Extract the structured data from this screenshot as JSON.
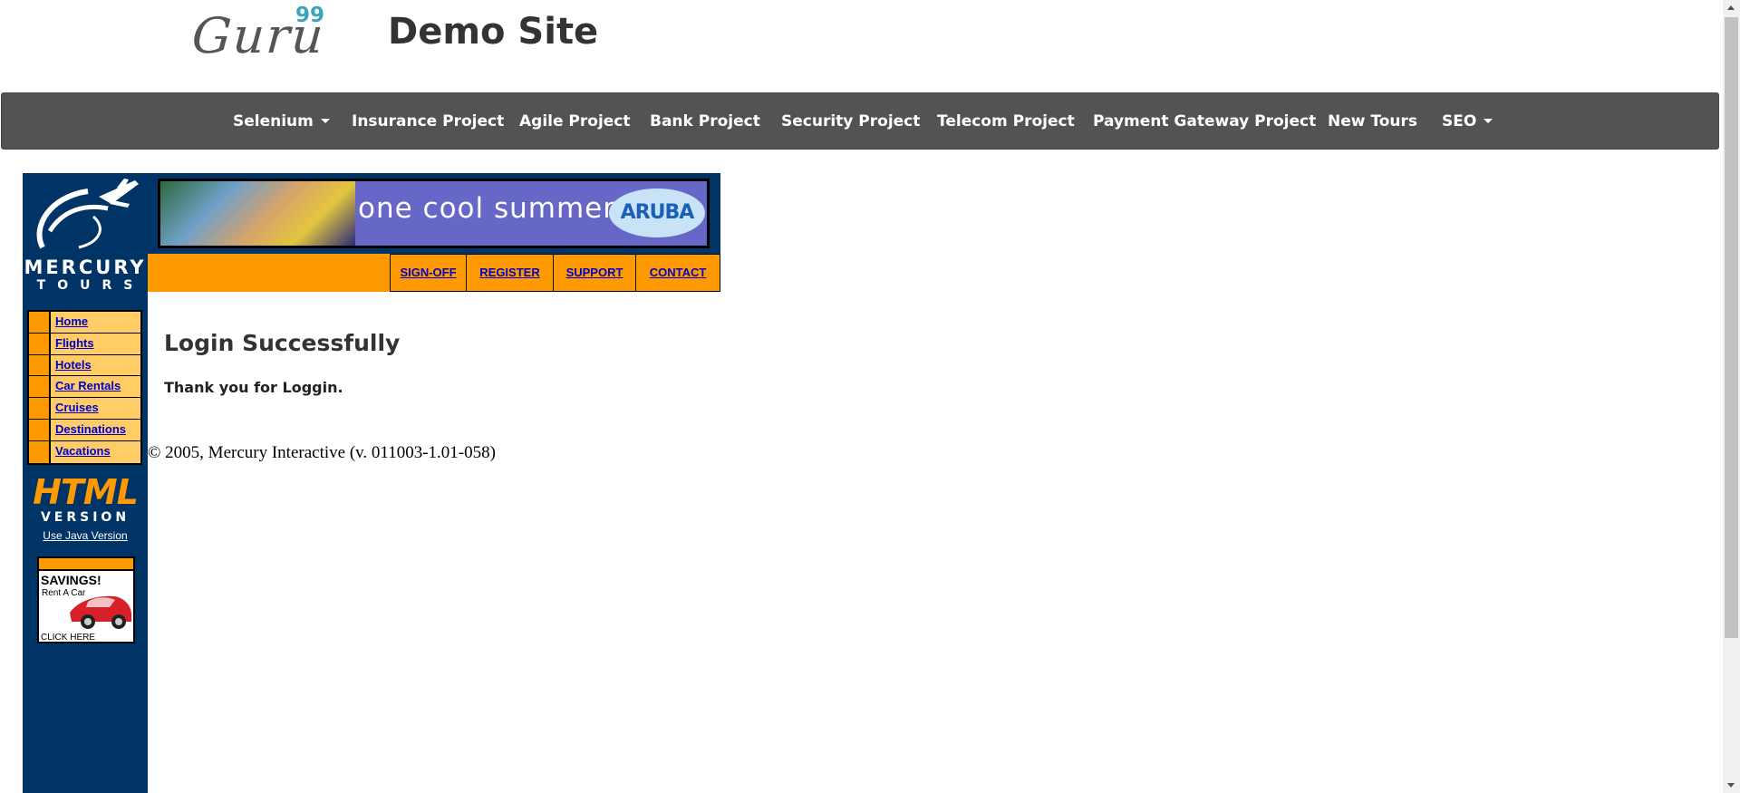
{
  "header": {
    "logo_text": "Guru",
    "logo_superscript": "99",
    "site_title": "Demo Site"
  },
  "navbar": {
    "items": [
      {
        "label": "Selenium",
        "dropdown": true
      },
      {
        "label": "Insurance Project"
      },
      {
        "label": "Agile Project"
      },
      {
        "label": "Bank Project"
      },
      {
        "label": "Security Project"
      },
      {
        "label": "Telecom Project"
      },
      {
        "label": "Payment Gateway Project"
      },
      {
        "label": "New Tours"
      },
      {
        "label": "SEO",
        "dropdown": true
      }
    ]
  },
  "mercury": {
    "logo_word1": "MERCURY",
    "logo_word2": "TOURS",
    "side_menu": [
      "Home",
      "Flights",
      "Hotels",
      "Car Rentals",
      "Cruises",
      "Destinations",
      "Vacations"
    ],
    "html_version_line1": "HTML",
    "html_version_line2": "VERSION",
    "java_link": "Use Java Version",
    "ad": {
      "title": "SAVINGS!",
      "subtitle": "Rent A Car",
      "cta": "CLICK HERE"
    },
    "banner": {
      "text": "one cool summer",
      "brand": "ARUBA"
    },
    "top_links": [
      "SIGN-OFF",
      "REGISTER",
      "SUPPORT",
      "CONTACT"
    ]
  },
  "content": {
    "heading": "Login Successfully",
    "message": "Thank you for Loggin.",
    "footer": "© 2005, Mercury Interactive (v. 011003-1.01-058)"
  },
  "colors": {
    "navbar_bg": "#535353",
    "mercury_navy": "#003366",
    "mercury_orange": "#ff9900",
    "menu_yellow": "#ffcc66",
    "link_blue": "#0000cc",
    "logo_accent": "#3ba4b8"
  }
}
